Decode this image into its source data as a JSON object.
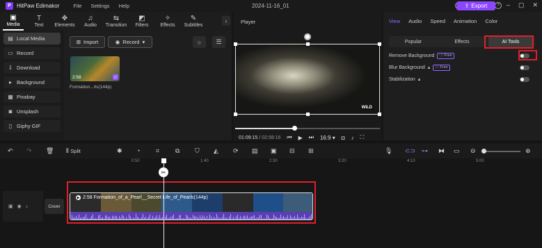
{
  "app": {
    "name": "HitPaw Edimakor",
    "logo_letter": "P"
  },
  "menu": [
    "File",
    "Settings",
    "Help"
  ],
  "document_title": "2024-11-16_01",
  "export_label": "Export",
  "toolbar_tabs": [
    {
      "label": "Media",
      "icon": "media-icon",
      "active": true
    },
    {
      "label": "Text",
      "icon": "text-icon"
    },
    {
      "label": "Elements",
      "icon": "elements-icon"
    },
    {
      "label": "Audio",
      "icon": "audio-icon"
    },
    {
      "label": "Transition",
      "icon": "transition-icon"
    },
    {
      "label": "Filters",
      "icon": "filters-icon"
    },
    {
      "label": "Effects",
      "icon": "effects-icon"
    },
    {
      "label": "Subtitles",
      "icon": "subtitles-icon"
    }
  ],
  "sidebar": {
    "items": [
      {
        "label": "Local Media",
        "icon": "local-media-icon",
        "active": true
      },
      {
        "label": "Record",
        "icon": "record-icon"
      },
      {
        "label": "Download",
        "icon": "download-icon"
      },
      {
        "label": "Background",
        "icon": "background-icon"
      },
      {
        "label": "Pixabay",
        "icon": "pixabay-icon"
      },
      {
        "label": "Unsplash",
        "icon": "unsplash-icon"
      },
      {
        "label": "Giphy GIF",
        "icon": "giphy-icon"
      }
    ]
  },
  "media": {
    "import_label": "Import",
    "record_label": "Record",
    "item": {
      "duration": "2:58",
      "name": "Formation...rls(144p)"
    }
  },
  "player": {
    "title": "Player",
    "current_time": "01:09:15",
    "total_time": "02:58:16",
    "aspect": "16:9",
    "progress": 0.41,
    "watermark": "WILD"
  },
  "properties": {
    "tabs": [
      "View",
      "Audio",
      "Speed",
      "Animation",
      "Color"
    ],
    "active_tab": "View",
    "subtabs": [
      "Popular",
      "Effects",
      "AI Tools"
    ],
    "active_subtab": "AI Tools",
    "rows": [
      {
        "label": "Remove Background",
        "badge": "Free",
        "has_arrow": false,
        "toggle_on": false
      },
      {
        "label": "Blur Background",
        "badge": "Free",
        "has_arrow": true,
        "toggle_on": false
      },
      {
        "label": "Stabilization",
        "badge": "",
        "has_arrow": true,
        "toggle_on": false
      }
    ],
    "highlight_color": "#e01f2c"
  },
  "timeline_toolbar": {
    "split_label": "Split"
  },
  "timeline": {
    "ruler_ticks": [
      "0:50",
      "1:40",
      "2:30",
      "3:20",
      "4:10",
      "5:00"
    ],
    "cover_label": "Cover",
    "clip_title": "2:58 Formation_of_a_Pearl__Secret Life_of_Pearls(144p)"
  },
  "colors": {
    "accent": "#8b46ff",
    "background": "#151515",
    "highlight": "#e01f2c"
  }
}
